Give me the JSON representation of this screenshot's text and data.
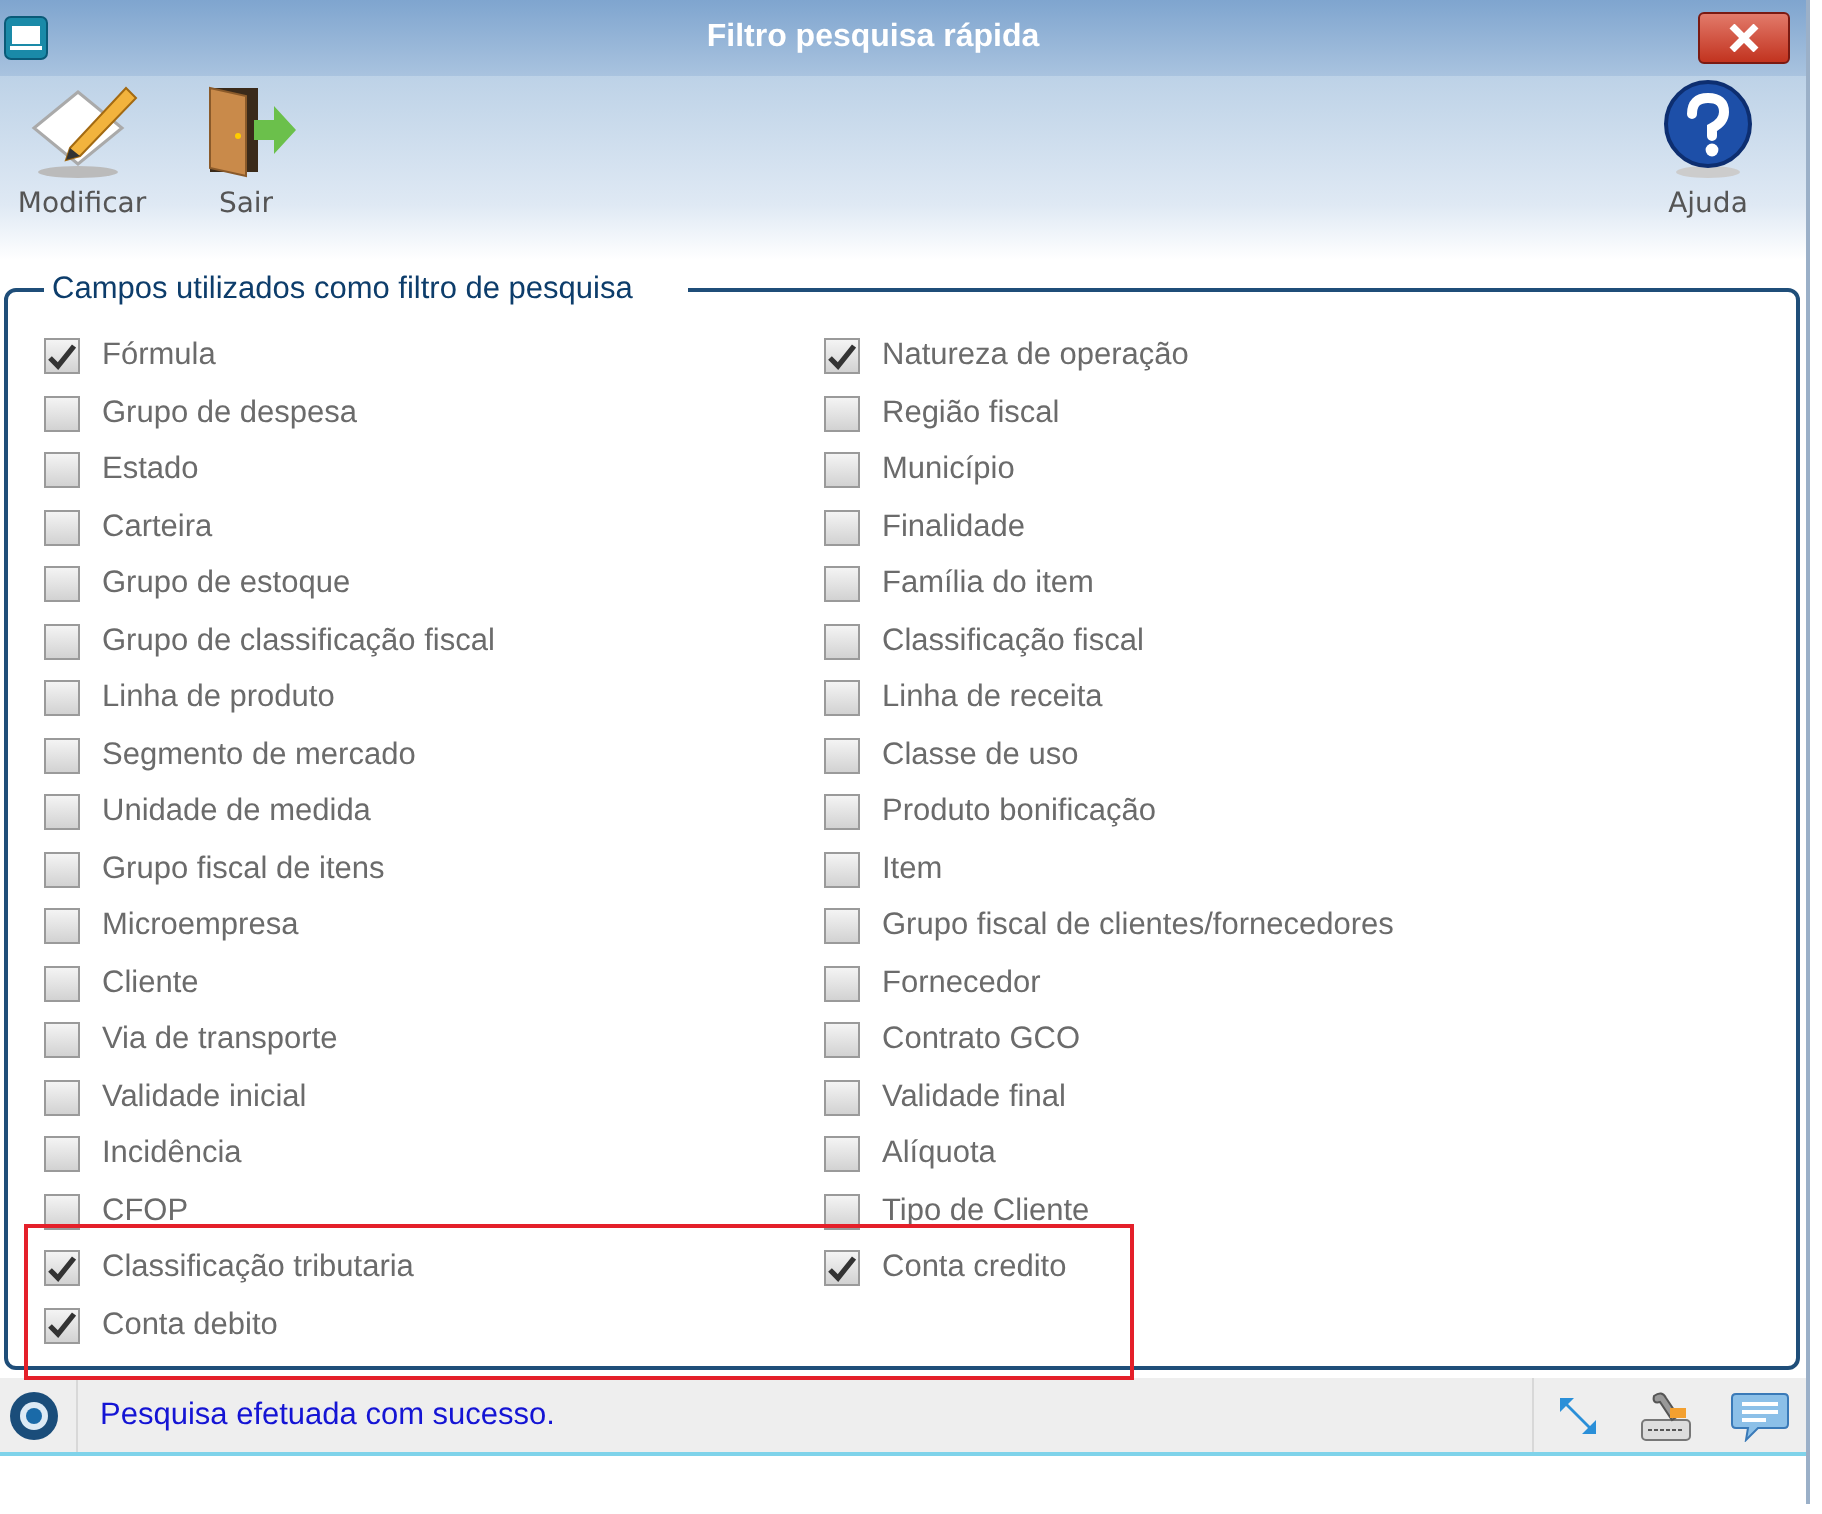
{
  "window": {
    "title": "Filtro pesquisa rápida"
  },
  "toolbar": {
    "left": [
      {
        "kind": "edit",
        "label": "Modificar"
      },
      {
        "kind": "exit",
        "label": "Sair"
      }
    ],
    "right": [
      {
        "kind": "help",
        "label": "Ajuda"
      }
    ]
  },
  "filter_group": {
    "legend": "Campos utilizados como filtro de pesquisa",
    "highlight_box": true,
    "columns": [
      [
        {
          "label": "Fórmula",
          "checked": true
        },
        {
          "label": "Grupo de despesa",
          "checked": false
        },
        {
          "label": "Estado",
          "checked": false
        },
        {
          "label": "Carteira",
          "checked": false
        },
        {
          "label": "Grupo de estoque",
          "checked": false
        },
        {
          "label": "Grupo de classificação fiscal",
          "checked": false
        },
        {
          "label": "Linha de produto",
          "checked": false
        },
        {
          "label": "Segmento de mercado",
          "checked": false
        },
        {
          "label": "Unidade de medida",
          "checked": false
        },
        {
          "label": "Grupo fiscal de itens",
          "checked": false
        },
        {
          "label": "Microempresa",
          "checked": false
        },
        {
          "label": "Cliente",
          "checked": false
        },
        {
          "label": "Via de transporte",
          "checked": false
        },
        {
          "label": "Validade inicial",
          "checked": false
        },
        {
          "label": "Incidência",
          "checked": false
        },
        {
          "label": "CFOP",
          "checked": false
        },
        {
          "label": "Classificação tributaria",
          "checked": true
        },
        {
          "label": "Conta debito",
          "checked": true
        }
      ],
      [
        {
          "label": "Natureza de operação",
          "checked": true
        },
        {
          "label": "Região fiscal",
          "checked": false
        },
        {
          "label": "Município",
          "checked": false
        },
        {
          "label": "Finalidade",
          "checked": false
        },
        {
          "label": "Família do item",
          "checked": false
        },
        {
          "label": "Classificação fiscal",
          "checked": false
        },
        {
          "label": "Linha de receita",
          "checked": false
        },
        {
          "label": "Classe de uso",
          "checked": false
        },
        {
          "label": "Produto bonificação",
          "checked": false
        },
        {
          "label": "Item",
          "checked": false
        },
        {
          "label": "Grupo fiscal de clientes/fornecedores",
          "checked": false
        },
        {
          "label": "Fornecedor",
          "checked": false
        },
        {
          "label": "Contrato GCO",
          "checked": false
        },
        {
          "label": "Validade final",
          "checked": false
        },
        {
          "label": "Alíquota",
          "checked": false
        },
        {
          "label": "Tipo de Cliente",
          "checked": false
        },
        {
          "label": "Conta credito",
          "checked": true
        }
      ]
    ]
  },
  "status_bar": {
    "message": "Pesquisa efetuada com sucesso."
  }
}
